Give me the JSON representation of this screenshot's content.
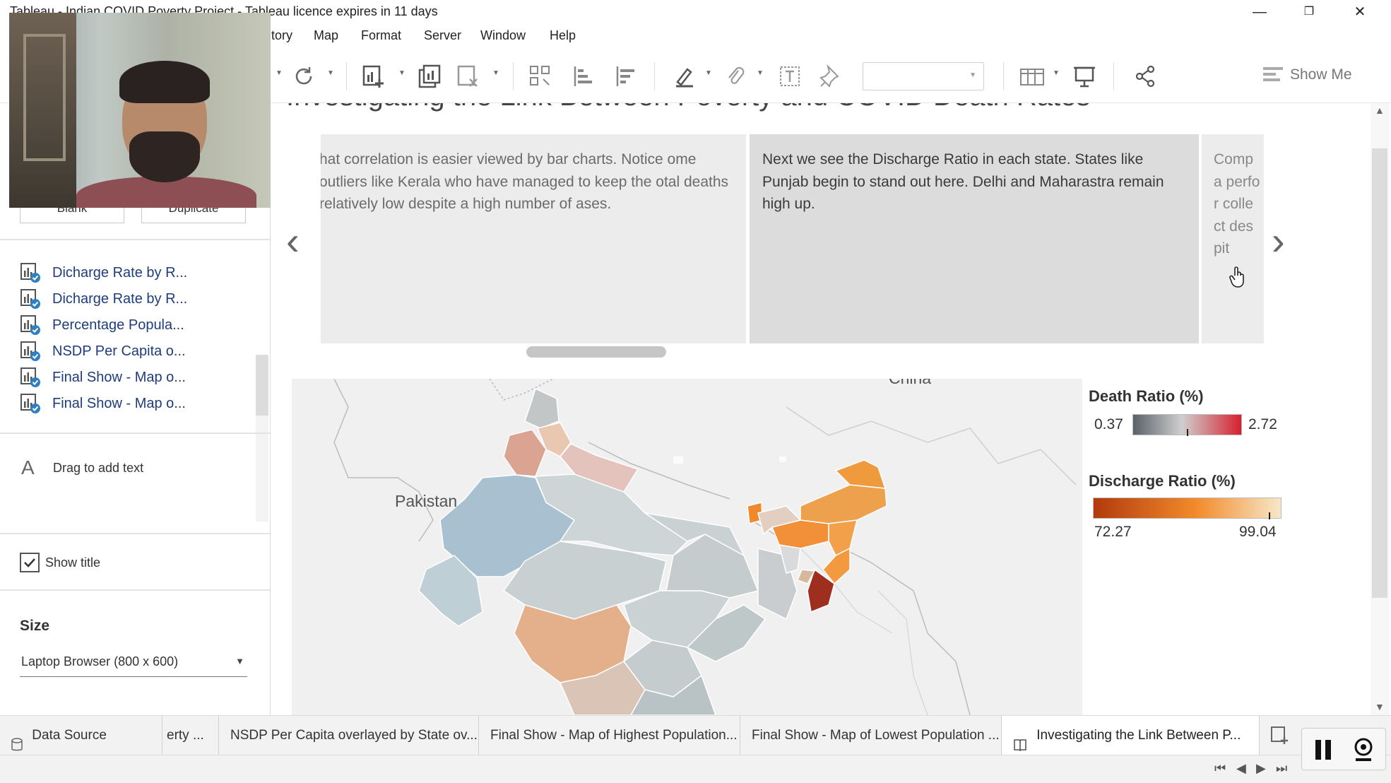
{
  "window": {
    "title": "Tableau - Indian COVID Poverty Project - Tableau licence expires in 11 days",
    "minimize": "—",
    "restore": "❐",
    "close": "✕"
  },
  "menu": {
    "items": [
      "tory",
      "Map",
      "Format",
      "Server",
      "Window",
      "Help"
    ]
  },
  "toolbar": {
    "show_me_label": "Show Me"
  },
  "left_panel": {
    "buttons": {
      "blank": "Blank",
      "duplicate": "Duplicate"
    },
    "sheets": [
      "Dicharge Rate by R...",
      "Dicharge Rate by R...",
      "Percentage Popula...",
      "NSDP Per Capita o...",
      "Final Show - Map o...",
      "Final Show - Map o..."
    ],
    "drag_text_label": "Drag to add text",
    "drag_text_icon": "A",
    "show_title_label": "Show title",
    "show_title_checked": true,
    "size_heading": "Size",
    "size_value": "Laptop Browser (800 x 600)"
  },
  "story": {
    "title": "Investigating the Link Between Poverty and COVID Death Rates",
    "captions": [
      "hat correlation is easier viewed by bar charts. Notice ome outliers like Kerala who have managed to keep the otal deaths relatively low despite a high number of ases.",
      "Next we see the Discharge Ratio in each state.  States like Punjab begin to stand out here. Delhi and Maharastra remain high up.",
      "Compa perfor collect despit"
    ],
    "map_labels": {
      "pakistan": "Pakistan",
      "china": "China"
    }
  },
  "legends": {
    "death": {
      "title": "Death Ratio (%)",
      "min": "0.37",
      "max": "2.72",
      "colors": [
        "#5b6169",
        "#cfcfcf",
        "#d6202e"
      ]
    },
    "discharge": {
      "title": "Discharge Ratio (%)",
      "min": "72.27",
      "max": "99.04",
      "colors": [
        "#b23a0d",
        "#f28b2c",
        "#f7e7c7"
      ]
    }
  },
  "tabs": {
    "data_source": "Data Source",
    "items": [
      "erty ...",
      "NSDP Per Capita overlayed by State ov...",
      "Final Show - Map of Highest Population...",
      "Final Show - Map of Lowest Population ...",
      "Investigating the Link Between P..."
    ]
  },
  "statusbar": {
    "nav": [
      "⏮",
      "◀",
      "▶",
      "⏭"
    ]
  },
  "colors": {
    "accent_blue": "#1f3d7a",
    "caption_active": "#dcdcdc"
  }
}
